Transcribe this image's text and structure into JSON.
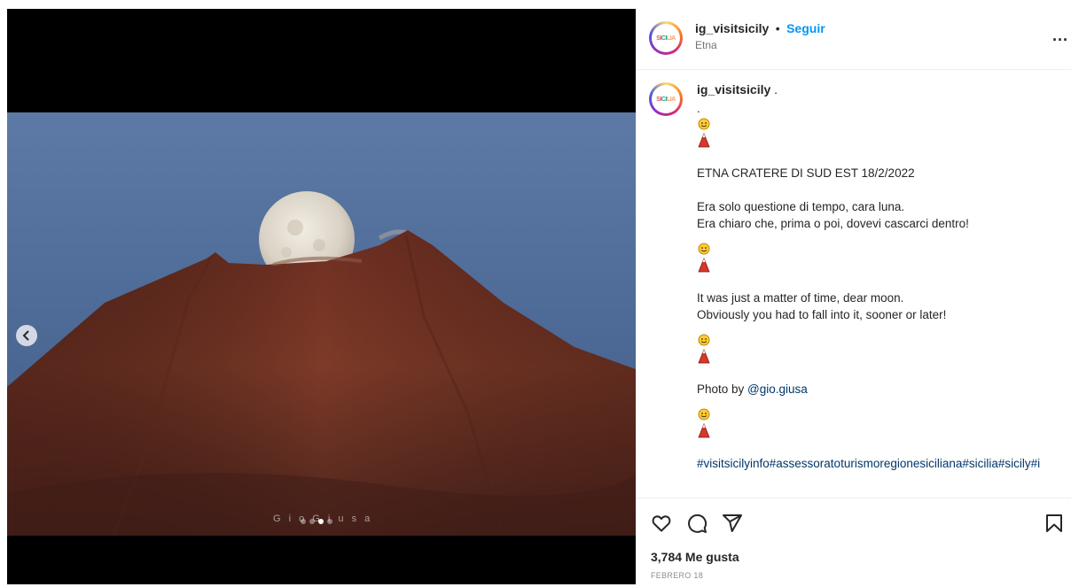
{
  "post": {
    "username": "ig_visitsicily",
    "follow_label": "Seguir",
    "separator": "•",
    "location": "Etna",
    "more_label": "...",
    "avatar_text": [
      "SI",
      "CI",
      "LIA"
    ]
  },
  "caption": {
    "username": "ig_visitsicily",
    "first_line": ".",
    "dot_line": ".",
    "title": "ETNA CRATERE DI SUD EST 18/2/2022",
    "it_line1": "Era solo questione di tempo, cara luna.",
    "it_line2": "Era chiaro che, prima o poi, dovevi cascarci dentro!",
    "en_line1": "It was just a matter of time, dear moon.",
    "en_line2": "Obviously you had to fall into it, sooner or later!",
    "photo_by_prefix": "Photo by ",
    "photo_by_handle": "@gio.giusa",
    "hashtags": "#visitsicilyinfo#assessoratoturismoregionesiciliana#sicilia#sicily#i"
  },
  "media": {
    "watermark": "G i o   G i u s a",
    "carousel_dots": 4,
    "active_dot": 3
  },
  "footer": {
    "likes": "3,784 Me gusta",
    "date": "FEBRERO 18"
  },
  "colors": {
    "sky": "#4f6e9b",
    "mountain": "#7a3524",
    "link": "#00376b",
    "follow": "#0095f6"
  },
  "icons": [
    "heart-icon",
    "comment-icon",
    "share-icon",
    "bookmark-icon",
    "chevron-left-icon",
    "more-icon"
  ]
}
